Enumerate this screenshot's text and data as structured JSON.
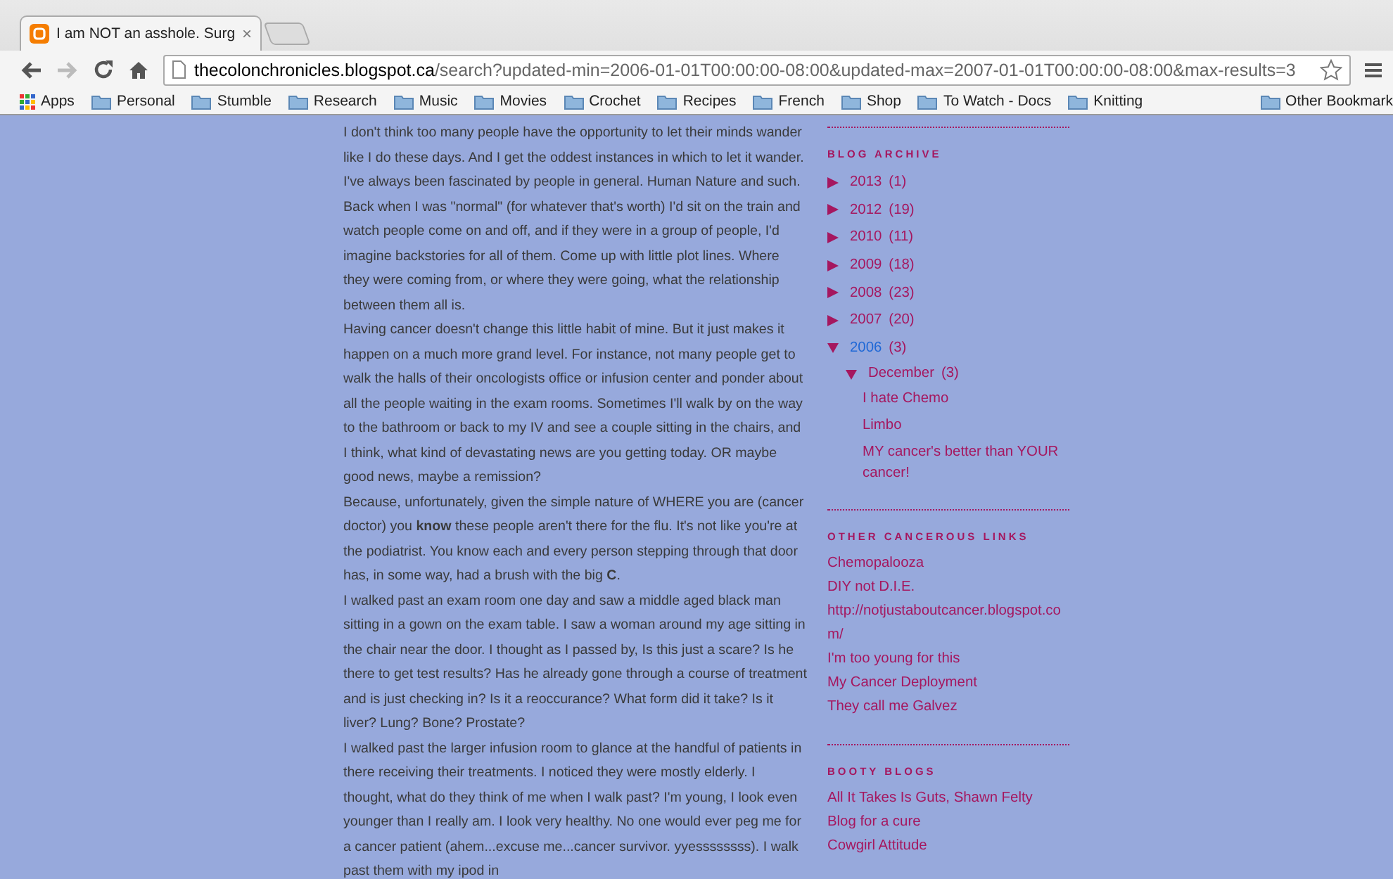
{
  "browser": {
    "tabs": [
      {
        "title": "I am NOT an asshole. Surg",
        "close": "×",
        "selected": true
      }
    ],
    "address": {
      "host": "thecolonchronicles.blogspot.ca",
      "path": "/search?updated-min=2006-01-01T00:00:00-08:00&updated-max=2007-01-01T00:00:00-08:00&max-results=3"
    },
    "forward_disabled": true,
    "bookmarks": [
      {
        "label": "Apps",
        "kind": "apps"
      },
      {
        "label": "Personal",
        "kind": "folder"
      },
      {
        "label": "Stumble",
        "kind": "folder"
      },
      {
        "label": "Research",
        "kind": "folder"
      },
      {
        "label": "Music",
        "kind": "folder"
      },
      {
        "label": "Movies",
        "kind": "folder"
      },
      {
        "label": "Crochet",
        "kind": "folder"
      },
      {
        "label": "Recipes",
        "kind": "folder"
      },
      {
        "label": "French",
        "kind": "folder"
      },
      {
        "label": "Shop",
        "kind": "folder"
      },
      {
        "label": "To Watch - Docs",
        "kind": "folder"
      },
      {
        "label": "Knitting",
        "kind": "folder"
      }
    ],
    "other_bookmarks": "Other Bookmark"
  },
  "post": {
    "paragraphs": [
      "I don't think too many people have the opportunity to let their minds wander like I do these days. And I get the oddest instances in which to let it wander.",
      "I've always been fascinated by people in general. Human Nature and such. Back when I was \"normal\" (for whatever that's worth) I'd sit on the train and watch people come on and off, and if they were in a group of people, I'd imagine backstories for all of them. Come up with little plot lines. Where they were coming from, or where they were going, what the relationship between them all is.",
      "Having cancer doesn't change this little habit of mine. But it just makes it happen on a much more grand level. For instance, not many people get to walk the halls of their oncologists office or infusion center and ponder about all the people waiting in the exam rooms. Sometimes I'll walk by on the way to the bathroom or back to my IV and see a couple sitting in the chairs, and I think, what kind of devastating news are you getting today. OR maybe good news, maybe a remission?",
      "Because, unfortunately, given the simple nature of WHERE you are (cancer doctor) you **know** these people aren't there for the flu. It's not like you're at the podiatrist. You know each and every person stepping through that door has, in some way, had a brush with the big **C**.",
      "I walked past an exam room one day and saw a middle aged black man sitting in a gown on the exam table. I saw a woman around my age sitting in the chair near the door. I thought as I passed by, Is this just a scare? Is he there to get test results? Has he already gone through a course of treatment and is just checking in? Is it a reoccurance? What form did it take? Is it liver? Lung? Bone? Prostate?",
      "I walked past the larger infusion room to glance at the handful of patients in there receiving their treatments. I noticed they were mostly elderly. I thought, what do they think of me when I walk past? I'm young, I look even younger than I really am. I look very healthy. No one would ever peg me for a cancer patient (ahem...excuse me...cancer survivor. yyessssssss). I walk past them with my ipod in"
    ]
  },
  "sidebar": {
    "archive": {
      "heading": "BLOG ARCHIVE",
      "years": [
        {
          "label": "2013",
          "count": "(1)",
          "expanded": false,
          "selected": false
        },
        {
          "label": "2012",
          "count": "(19)",
          "expanded": false,
          "selected": false
        },
        {
          "label": "2010",
          "count": "(11)",
          "expanded": false,
          "selected": false
        },
        {
          "label": "2009",
          "count": "(18)",
          "expanded": false,
          "selected": false
        },
        {
          "label": "2008",
          "count": "(23)",
          "expanded": false,
          "selected": false
        },
        {
          "label": "2007",
          "count": "(20)",
          "expanded": false,
          "selected": false
        },
        {
          "label": "2006",
          "count": "(3)",
          "expanded": true,
          "selected": true,
          "children": [
            {
              "label": "December",
              "count": "(3)",
              "expanded": true,
              "children": [
                {
                  "label": "I hate Chemo"
                },
                {
                  "label": "Limbo"
                },
                {
                  "label": "MY cancer's better than YOUR cancer!"
                }
              ]
            }
          ]
        }
      ]
    },
    "link_lists": [
      {
        "heading": "OTHER CANCEROUS LINKS",
        "links": [
          "Chemopalooza",
          "DIY not D.I.E.",
          "http://notjustaboutcancer.blogspot.com/",
          "I'm too young for this",
          "My Cancer Deployment",
          "They call me Galvez"
        ]
      },
      {
        "heading": "BOOTY BLOGS",
        "links": [
          "All It Takes Is Guts, Shawn Felty",
          "Blog for a cure",
          "Cowgirl Attitude"
        ]
      }
    ]
  }
}
